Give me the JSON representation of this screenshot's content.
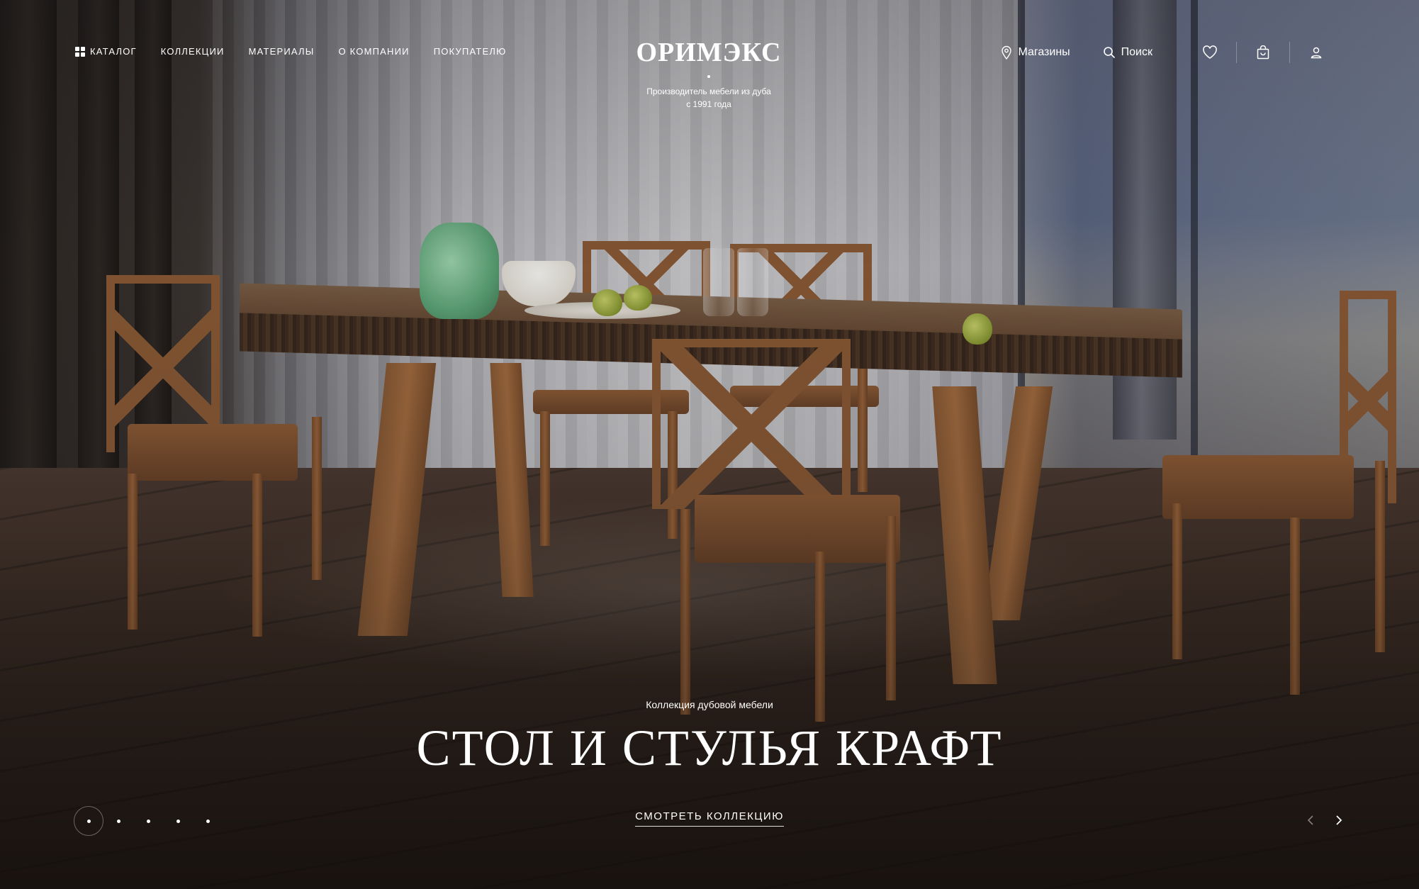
{
  "header": {
    "nav": [
      {
        "label": "КАТАЛОГ"
      },
      {
        "label": "КОЛЛЕКЦИИ"
      },
      {
        "label": "МАТЕРИАЛЫ"
      },
      {
        "label": "О КОМПАНИИ"
      },
      {
        "label": "ПОКУПАТЕЛЮ"
      }
    ],
    "brand": {
      "name": "ОРИМЭКС",
      "tagline_line1": "Производитель мебели из дуба",
      "tagline_line2": "с 1991 года"
    },
    "stores_label": "Магазины",
    "search_label": "Поиск",
    "icons": {
      "catalog": "grid-icon",
      "stores": "map-pin-icon",
      "search": "search-icon",
      "favorites": "heart-icon",
      "cart": "shopping-bag-icon",
      "account": "user-icon"
    }
  },
  "hero": {
    "eyebrow": "Коллекция дубовой мебели",
    "title": "СТОЛ И СТУЛЬЯ КРАФТ",
    "cta_label": "СМОТРЕТЬ КОЛЛЕКЦИЮ"
  },
  "slider": {
    "total_slides": 5,
    "active_slide": 1,
    "prev_icon": "chevron-left-icon",
    "next_icon": "chevron-right-icon"
  },
  "colors": {
    "text": "#ffffff",
    "overlay": "#141216"
  }
}
